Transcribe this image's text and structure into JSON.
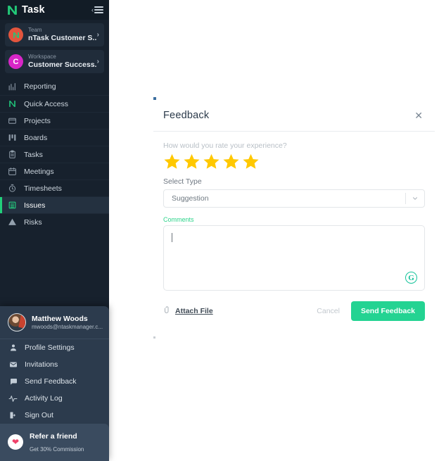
{
  "sidebar": {
    "brand": {
      "name": "Task",
      "logo_icon": "ntask-n-logo-icon",
      "collapse_icon": "collapse-menu-icon"
    },
    "switchers": [
      {
        "kicker": "Team",
        "name": "nTask Customer S...",
        "initial": "N",
        "color": "#e2553d",
        "chevron": "›"
      },
      {
        "kicker": "Workspace",
        "name": "Customer Success...",
        "initial": "C",
        "color": "#d726c7",
        "chevron": "›"
      }
    ],
    "nav": [
      {
        "label": "Reporting",
        "icon": "chart-bar-icon",
        "active": false
      },
      {
        "label": "Quick Access",
        "icon": "ntask-quick-access-icon",
        "active": false
      },
      {
        "label": "Projects",
        "icon": "folder-icon",
        "active": false
      },
      {
        "label": "Boards",
        "icon": "board-columns-icon",
        "active": false
      },
      {
        "label": "Tasks",
        "icon": "clipboard-icon",
        "active": false
      },
      {
        "label": "Meetings",
        "icon": "calendar-icon",
        "active": false
      },
      {
        "label": "Timesheets",
        "icon": "stopwatch-icon",
        "active": false
      },
      {
        "label": "Issues",
        "icon": "list-issues-icon",
        "active": true
      },
      {
        "label": "Risks",
        "icon": "warning-triangle-icon",
        "active": false
      }
    ],
    "profile": {
      "name": "Matthew Woods",
      "email": "mwoods@ntaskmanager.c...",
      "avatar_icon": "user-avatar-photo",
      "menu": [
        {
          "label": "Profile Settings",
          "icon": "person-icon"
        },
        {
          "label": "Invitations",
          "icon": "envelope-icon"
        },
        {
          "label": "Send Feedback",
          "icon": "chat-bubble-icon"
        },
        {
          "label": "Activity Log",
          "icon": "activity-pulse-icon"
        },
        {
          "label": "Sign Out",
          "icon": "sign-out-icon"
        }
      ],
      "refer": {
        "title": "Refer a friend",
        "subtitle": "Get 30% Commission",
        "icon": "heart-icon"
      }
    },
    "colors": {
      "background": "#17212d",
      "active_accent": "#21d07a",
      "panel": "#2c3b4d"
    }
  },
  "modal": {
    "title": "Feedback",
    "close_icon": "close-x-icon",
    "rating_question": "How would you rate your experience?",
    "rating": {
      "value": 5,
      "max": 5,
      "star_color": "#ffc800"
    },
    "type_field": {
      "label": "Select Type",
      "value": "Suggestion",
      "chevron_icon": "chevron-down-icon",
      "options": [
        "Suggestion"
      ]
    },
    "comments": {
      "label": "Comments",
      "value": "",
      "label_color": "#2bd38a",
      "assistant_icon": "grammarly-icon",
      "assistant_glyph": "G"
    },
    "attach": {
      "label": "Attach File",
      "icon": "paperclip-icon"
    },
    "cancel_label": "Cancel",
    "send_label": "Send Feedback",
    "send_color": "#24d392"
  }
}
